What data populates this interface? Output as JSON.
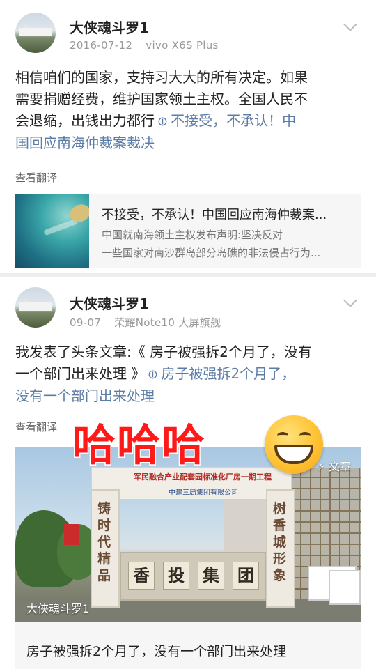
{
  "posts": [
    {
      "username": "大侠魂斗罗1",
      "date": "2016-07-12",
      "device": "vivo X6S Plus",
      "text_lines": [
        "相信咱们的国家，支持习大大的所有决定。如果",
        "需要捐赠经费，维护国家领土主权。全国人民不"
      ],
      "text_line3": "会退缩，出钱出力都行",
      "link_part1": "不接受，不承认！中",
      "link_part2": "国回应南海仲裁案裁决",
      "translate": "查看翻译",
      "card": {
        "title": "不接受，不承认！中国回应南海仲裁案...",
        "line1": "中国就南海领土主权发布声明:坚决反对",
        "line2": "一些国家对南沙群岛部分岛礁的非法侵占行为..."
      }
    },
    {
      "username": "大侠魂斗罗1",
      "date": "09-07",
      "device": "荣耀Note10 大屏旗舰",
      "text_line1": "我发表了头条文章:《 房子被强拆2个月了，没有",
      "text_line2_plain": "一个部门出来处理 》",
      "link_part1": "房子被强拆2个月了，",
      "link_part2": "没有一个部门出来处理",
      "translate": "查看翻译",
      "article": {
        "badge": "⚡ 文章",
        "watermark": "大侠魂斗罗1",
        "title": "房子被强拆2个月了，没有一个部门出来处理",
        "gate_banner": "军民融合产业配套园标准化厂房一期工程",
        "gate_sub": "中建三局集团有限公司",
        "pillar_left": "铸时代精品",
        "pillar_right": "树香城形象",
        "wall_chars": [
          "香",
          "投",
          "集",
          "团"
        ]
      }
    }
  ],
  "overlay_text": "哈哈哈",
  "icons": {
    "link": "link-icon",
    "dropdown": "chevron-down-icon",
    "emoji": "grinning-face-emoji"
  },
  "colors": {
    "link": "#5b7ca6",
    "overlay": "#ff1a1a",
    "meta": "#999999"
  }
}
